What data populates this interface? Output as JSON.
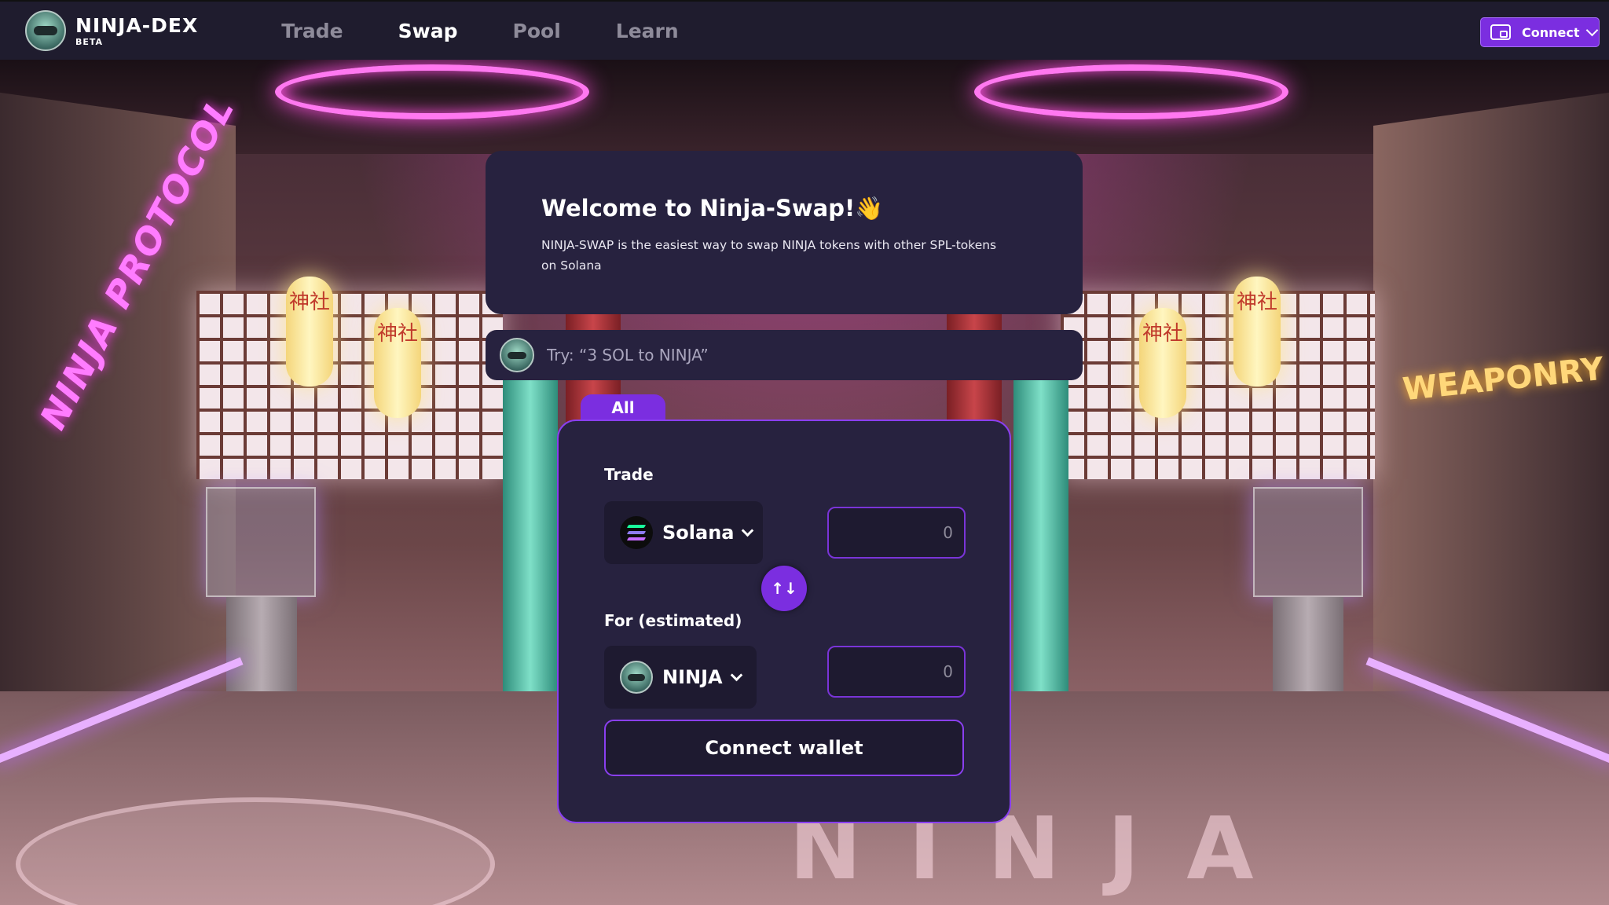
{
  "nav": {
    "brand_name": "NINJA-DEX",
    "brand_badge": "BETA",
    "links": [
      "Trade",
      "Swap",
      "Pool",
      "Learn"
    ],
    "active": "Swap",
    "connect_label": "Connect"
  },
  "welcome": {
    "title": "Welcome to Ninja-Swap!👋",
    "subtitle": "NINJA-SWAP is the easiest way to swap NINJA tokens with other SPL-tokens on Solana"
  },
  "search": {
    "placeholder": "Try: “3 SOL to NINJA”"
  },
  "swap": {
    "tab_label": "All",
    "trade_label": "Trade",
    "from_token": "Solana",
    "from_amount": "0",
    "swap_direction_icon": "↑↓",
    "for_label": "For (estimated)",
    "to_token": "NINJA",
    "to_amount": "0",
    "connect_wallet_label": "Connect wallet"
  },
  "background": {
    "left_sign": "NINJA PROTOCOL",
    "right_sign": "WEAPONRY",
    "lantern_text": "神社",
    "floor_text": "NINJA"
  },
  "colors": {
    "accent": "#7b2ee0",
    "card_bg": "#27223f",
    "nav_bg": "#1f1c2e"
  }
}
